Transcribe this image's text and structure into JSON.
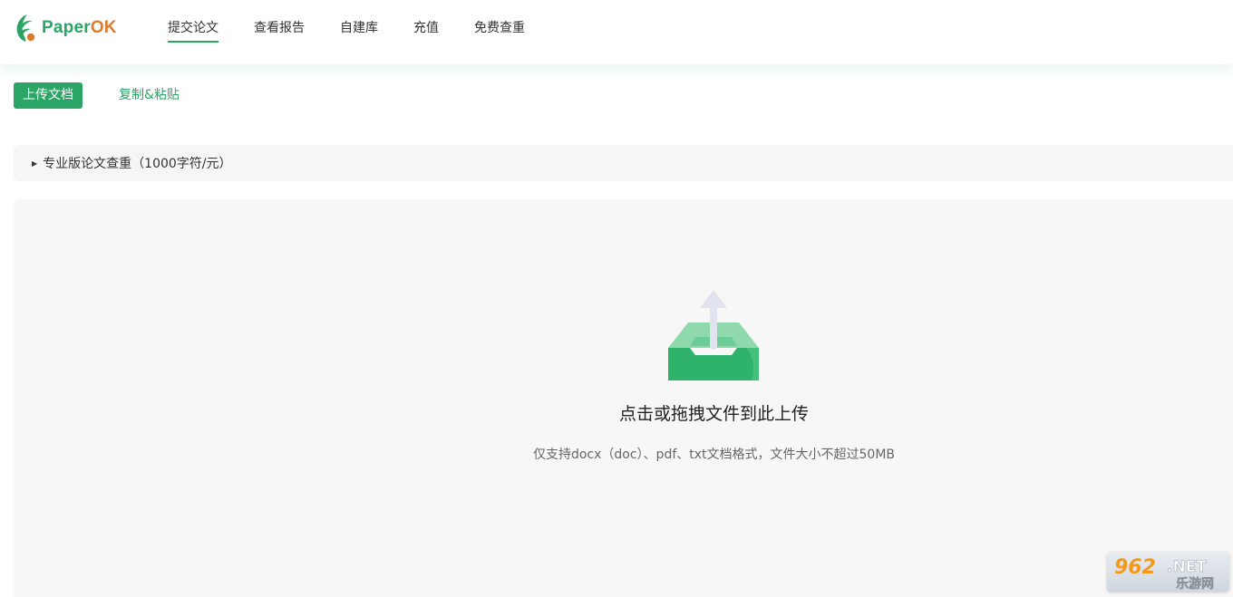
{
  "header": {
    "logo_text_part1": "Paper",
    "logo_text_part2": "OK",
    "nav": [
      {
        "label": "提交论文",
        "active": true
      },
      {
        "label": "查看报告"
      },
      {
        "label": "自建库"
      },
      {
        "label": "充值"
      },
      {
        "label": "免费查重"
      }
    ]
  },
  "tabs": {
    "upload_label": "上传文档",
    "paste_label": "复制&粘贴"
  },
  "plan": {
    "label": "专业版论文查重（1000字符/元）"
  },
  "dropzone": {
    "title": "点击或拖拽文件到此上传",
    "hint": "仅支持docx（doc）、pdf、txt文档格式，文件大小不超过50MB"
  },
  "colors": {
    "brand_green": "#2aa566",
    "brand_orange": "#e07a2c"
  },
  "icons": {
    "upload": "upload-tray-icon",
    "caret": "caret-right-icon"
  }
}
